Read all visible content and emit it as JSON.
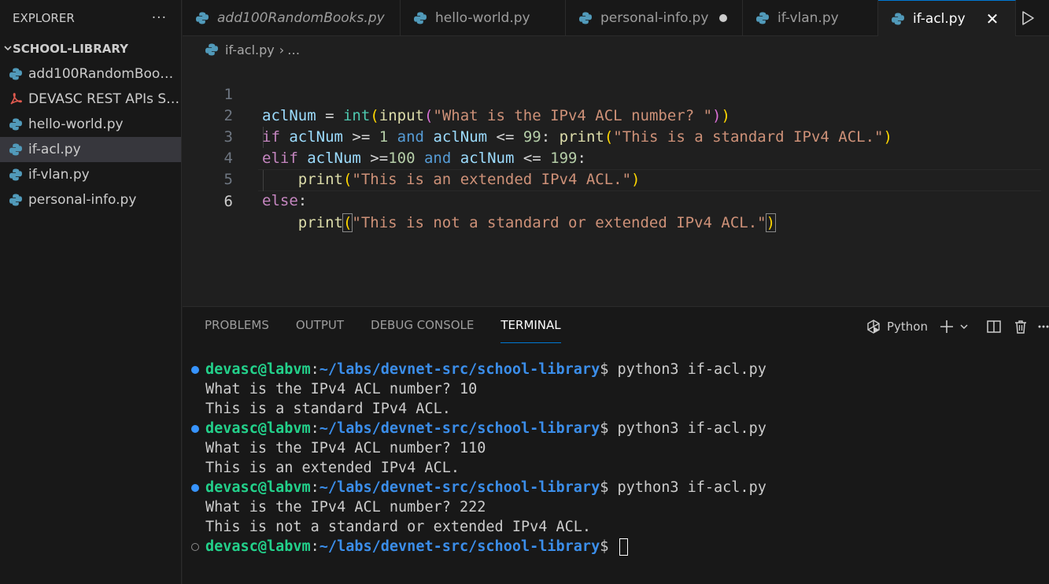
{
  "explorer": {
    "title": "EXPLORER",
    "more_label": "···",
    "folder": "SCHOOL-LIBRARY",
    "files": [
      {
        "label": "add100RandomBoo…",
        "icon": "python-icon"
      },
      {
        "label": "DEVASC REST APIs S…",
        "icon": "pdf-icon"
      },
      {
        "label": "hello-world.py",
        "icon": "python-icon"
      },
      {
        "label": "if-acl.py",
        "icon": "python-icon",
        "active": true
      },
      {
        "label": "if-vlan.py",
        "icon": "python-icon"
      },
      {
        "label": "personal-info.py",
        "icon": "python-icon"
      }
    ]
  },
  "tabs": [
    {
      "label": "add100RandomBooks.py",
      "italic": true
    },
    {
      "label": "hello-world.py"
    },
    {
      "label": "personal-info.py",
      "modified": true
    },
    {
      "label": "if-vlan.py"
    },
    {
      "label": "if-acl.py",
      "active": true,
      "close": "✕"
    }
  ],
  "breadcrumb": {
    "file": "if-acl.py",
    "sep": "›",
    "rest": "…"
  },
  "editor": {
    "line_numbers": [
      "1",
      "2",
      "3",
      "4",
      "5",
      "6"
    ],
    "current_line": 6
  },
  "panel": {
    "tabs": [
      "PROBLEMS",
      "OUTPUT",
      "DEBUG CONSOLE",
      "TERMINAL"
    ],
    "active_tab": "TERMINAL",
    "shell_label": "Python",
    "terminal": {
      "user": "devasc@labvm",
      "path": "~/labs/devnet-src/school-library",
      "prompt_suffix": "$ ",
      "command": "python3 if-acl.py",
      "outputs": [
        [
          "What is the IPv4 ACL number? 10",
          "This is a standard IPv4 ACL."
        ],
        [
          "What is the IPv4 ACL number? 110",
          "This is an extended IPv4 ACL."
        ],
        [
          "What is the IPv4 ACL number? 222",
          "This is not a standard or extended IPv4 ACL."
        ]
      ]
    }
  },
  "colors": {
    "accent": "#0078d4",
    "python_icon": "#519aba",
    "pdf_icon": "#e05a4f",
    "terminal_user": "#23d18b",
    "terminal_path": "#3b8eea"
  }
}
